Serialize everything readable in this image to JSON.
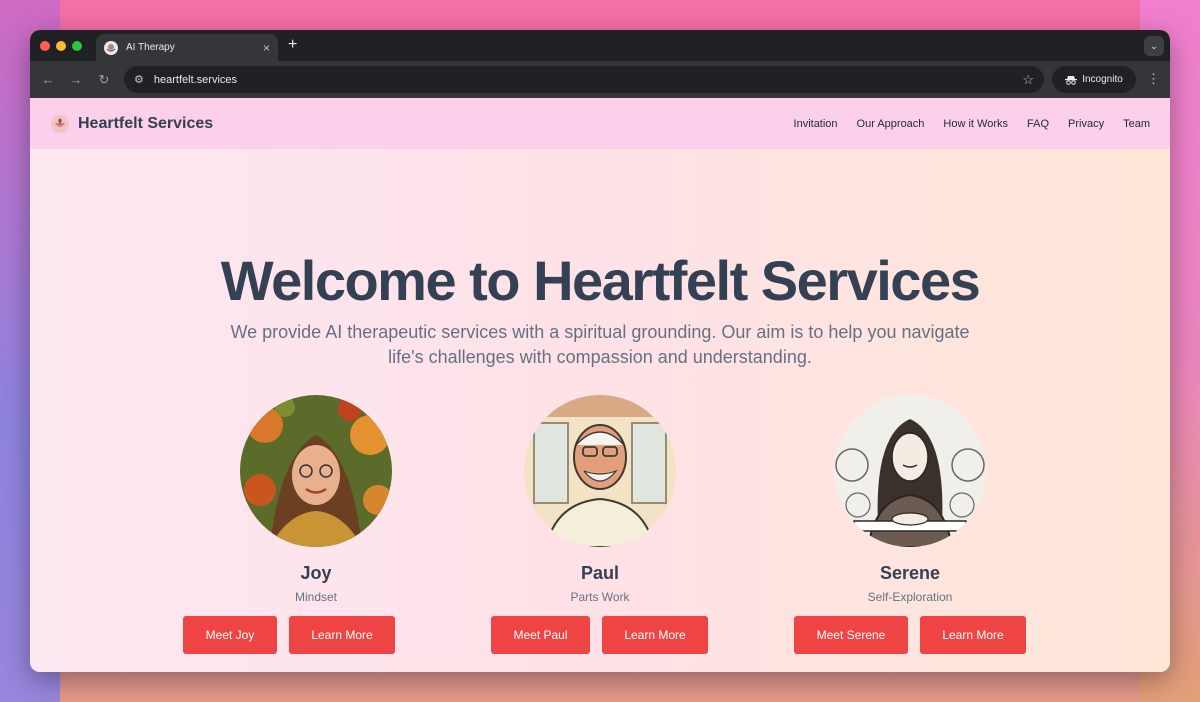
{
  "browser": {
    "tab_title": "AI Therapy",
    "tab_close": "×",
    "new_tab": "+",
    "url": "heartfelt.services",
    "incognito_label": "Incognito"
  },
  "site": {
    "brand_name": "Heartfelt Services",
    "nav": [
      "Invitation",
      "Our Approach",
      "How it Works",
      "FAQ",
      "Privacy",
      "Team"
    ]
  },
  "hero": {
    "title": "Welcome to Heartfelt Services",
    "subtitle": "We provide AI therapeutic services with a spiritual grounding. Our aim is to help you navigate life's challenges with compassion and understanding."
  },
  "therapists": [
    {
      "name": "Joy",
      "role": "Mindset",
      "meet_label": "Meet Joy",
      "learn_label": "Learn More"
    },
    {
      "name": "Paul",
      "role": "Parts Work",
      "meet_label": "Meet Paul",
      "learn_label": "Learn More"
    },
    {
      "name": "Serene",
      "role": "Self-Exploration",
      "meet_label": "Meet Serene",
      "learn_label": "Learn More"
    }
  ],
  "colors": {
    "accent_button": "#ef4444",
    "heading": "#344054",
    "header_bg": "#fcd0ea"
  },
  "icons": [
    "back-icon",
    "forward-icon",
    "reload-icon",
    "site-settings-icon",
    "star-icon",
    "incognito-icon",
    "menu-icon",
    "tab-search-icon",
    "brand-logo-icon"
  ]
}
